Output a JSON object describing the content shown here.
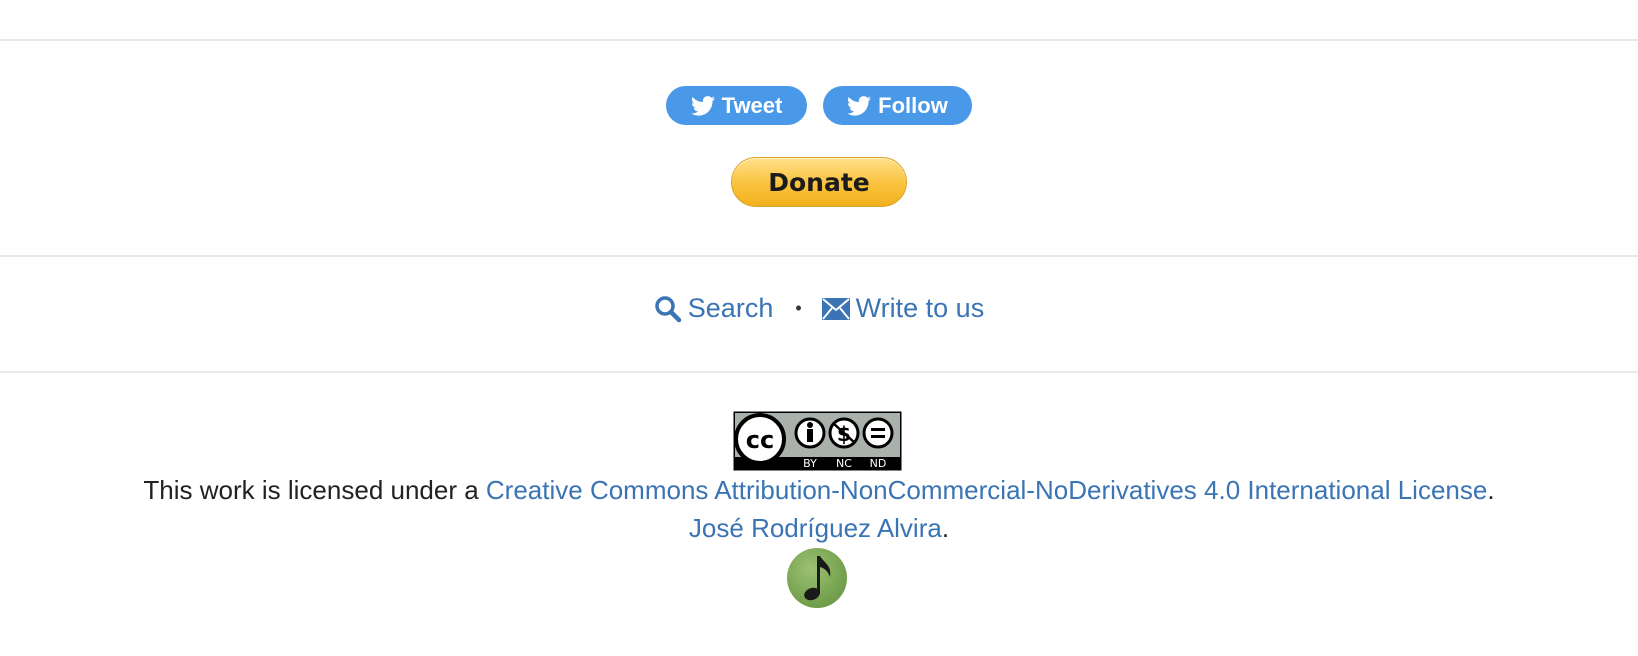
{
  "social": {
    "tweet_label": "Tweet",
    "follow_label": "Follow",
    "icon": "twitter-bird-icon",
    "color": "#4a99e9"
  },
  "donate": {
    "label": "Donate",
    "color": "#f9c23c"
  },
  "links": {
    "search_label": "Search",
    "search_icon": "magnifier-icon",
    "separator": "•",
    "write_label": "Write to us",
    "write_icon": "envelope-icon",
    "color": "#3a74b4"
  },
  "license": {
    "badge_labels": [
      "BY",
      "NC",
      "ND"
    ],
    "prefix": "This work is licensed under a ",
    "link_text": "Creative Commons Attribution-NonCommercial-NoDerivatives 4.0 International License",
    "suffix": "."
  },
  "author": {
    "name": "José Rodríguez Alvira",
    "suffix": "."
  },
  "logo": {
    "icon": "eighth-note-icon",
    "color": "#7aa654"
  }
}
